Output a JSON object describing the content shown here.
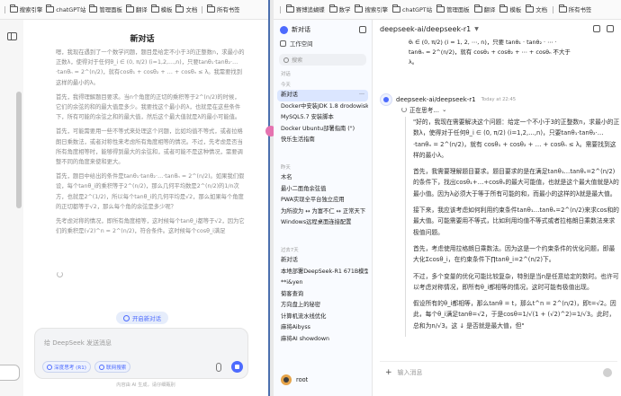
{
  "left_window": {
    "bookmarks": [
      "搜索引擎",
      "chatGPT站",
      "管理面板",
      "翻译",
      "模板",
      "文档",
      "所有书签"
    ],
    "chat_title": "新对话",
    "body_paragraphs": [
      "嗯，我现在遇到了一个数学问题，题目是给定不小于3的正整数n，求最小的正数λ，使得对于任何θ_i ∈ (0, π/2) (i=1,2,…,n)，只要tanθ₁·tanθ₂·…·tanθₙ = 2^(n/2)，就有cosθ₁ + cosθ₂ + … + cosθₙ ≤ λ。我需要找到这样的最小的λ。",
      "首先，我得理解题目要求。当n个角度的正切的乘积等于2^(n/2)的时候，它们的余弦的和的最大值是多少。我要找这个最小的λ，也就是在这些条件下，所有可能的余弦之和的最大值，然后这个最大值就是λ的最小可能值。",
      "首先，可能需要用一些不等式来处理这个问题，比如均值不等式，或者拉格朗日乘数法，或者对称性来考虑所有角度相等的情况。不过，先考虑是否当所有角度相等时，能够得到最大的余弦和，或者可能不是这种情况，需要调整不同的角度来使和更大。",
      "首先，题目中给出的条件是tanθ₁·tanθ₂·…·tanθₙ = 2^(n/2)。如果我们假设，每个tanθ_i的乘积等于2^(n/2)，那么几何平均数是2^(n/2)的1/n次方，也就是2^(1/2)，所以每个tanθ_i的几何平均是√2，那么如果每个角度的正切都等于√2，那么每个角的余弦是多少呢？",
      "先考虑对称的情况，即所有角度相等，这时候每个tanθ_i都等于√2，因为它们的乘积是(√2)^n = 2^(n/2)，符合条件。这时候每个cosθ_i满足"
    ],
    "new_chat_button": "开启新对话",
    "input_placeholder": "给 DeepSeek 发送消息",
    "chip_deepthink": "深度思考 (R1)",
    "chip_search": "联网搜索",
    "footer_note": "内容由 AI 生成，请仔细甄别"
  },
  "right_window": {
    "bookmarks": [
      "赛博追蝴蝶",
      "数学",
      "搜索引擎",
      "chatGPT站",
      "管理面板",
      "翻译",
      "模板",
      "文档",
      "所有书签"
    ],
    "sidebar": {
      "title": "新对话",
      "workspace": "工作空间",
      "search_placeholder": "搜索",
      "pinned_label": "对话",
      "today_label": "今天",
      "today_items": [
        "新对话",
        "Docker中安装JDK 1.8 drodowisko",
        "MySQL5.7 安装脚本",
        "Docker Ubuntu部署指南 (\")",
        "快乐生活指南"
      ],
      "yesterday_label": "昨天",
      "yesterday_items": [
        "木名",
        "最小二面角余弦值",
        "PWA实现全平台独立应用",
        "为所欲为 ↔ 为富不仁 ↔ 正常天下",
        "Windows远程桌面连接配置"
      ],
      "week_label": "过去7天",
      "week_items": [
        "新对话",
        "本地部署DeepSeek-R1 671B模型",
        "**i&yen",
        "菊客查询",
        "方向盘上的秘密",
        "计算机流水线优化",
        "麻将Aibyss",
        "麻将AI showdown"
      ],
      "user": "root"
    },
    "main": {
      "model_title": "deepseek-ai/deepseek-r1",
      "math_lines": [
        "θᵢ ∈ (0, π/2) (i = 1, 2, ⋯, n)，只要 tanθ₁ · tanθ₂ · ⋯ ·",
        "tanθₙ = 2^(n/2)，就有 cosθ₁ + cosθ₂ + ⋯ + cosθₙ 不大于",
        "λ。"
      ],
      "model_name": "deepseek-ai/deepseek-r1",
      "model_time": "Today at 22:45",
      "thinking_label": "正在思考…",
      "thinking_paragraphs": [
        "\"好的，我现在需要解决这个问题：给定一个不小于3的正整数n，求最小的正数λ，使得对于任何θ_i ∈ (0, π/2) (i=1,2,…,n)，只要tanθ₁·tanθ₂·…·tanθₙ = 2^(n/2)，就有 cosθ₁ + cosθ₂ + … + cosθₙ ≤ λ。需要找到这样的最小λ。",
        "首先，我需要理解题目要求。题目要求的是在满足tanθ₁…tanθₙ=2^(n/2)的条件下，找出cosθ₁+…+cosθₙ的最大可能值，也就是这个最大值就是λ的最小值。因为λ必须大于等于所有可能的和，而最小的这样的λ就是最大值。",
        "接下来，我应该考虑如何利用约束条件tanθ₁…tanθₙ=2^(n/2)来求cos和的最大值。可能需要用不等式，比如利用均值不等式或者拉格朗日乘数法来求极值问题。",
        "首先，考虑使用拉格朗日乘数法。因为这是一个约束条件的优化问题，即最大化Σcosθ_i，在约束条件下∏tanθ_i=2^(n/2)下。",
        "不过，多个变量的优化可能比较复杂，特别是当n是任意给定的数时。也许可以考虑对称情况，即所有θ_i都相等的情况，这时可能有极值出现。",
        "假设所有的θ_i都相等，那么tanθ = t，那么t^n = 2^(n/2)，即t=√2。因此，每个θ_i满足tanθ=√2，于是cosθ=1/√(1 + (√2)^2)=1/√3。此时，总和为n/√3。这 ↓ 是否就是最大值，但\""
      ],
      "input_placeholder": "输入消息"
    }
  }
}
